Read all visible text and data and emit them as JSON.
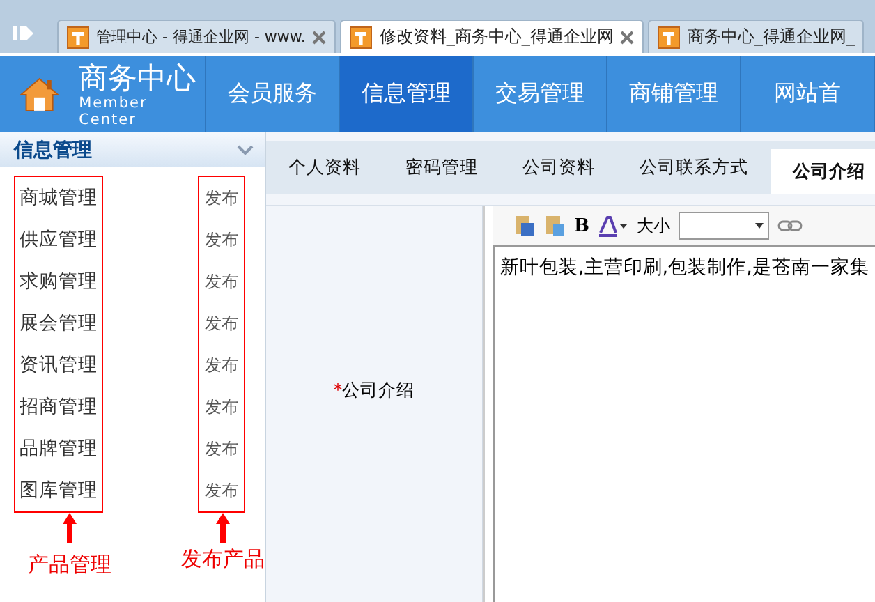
{
  "browser_tabs": [
    {
      "title": "管理中心 - 得通企业网 - www.",
      "selected": false,
      "closable": true
    },
    {
      "title": "修改资料_商务中心_得通企业网",
      "selected": true,
      "closable": true
    },
    {
      "title": "商务中心_得通企业网_",
      "selected": false,
      "closable": false
    }
  ],
  "header": {
    "title": "商务中心",
    "subtitle": "Member Center"
  },
  "nav": [
    {
      "label": "会员服务",
      "selected": false
    },
    {
      "label": "信息管理",
      "selected": true
    },
    {
      "label": "交易管理",
      "selected": false
    },
    {
      "label": "商铺管理",
      "selected": false
    },
    {
      "label": "网站首",
      "selected": false
    }
  ],
  "sidebar": {
    "title": "信息管理",
    "items": [
      {
        "label": "商城管理",
        "action": "发布"
      },
      {
        "label": "供应管理",
        "action": "发布"
      },
      {
        "label": "求购管理",
        "action": "发布"
      },
      {
        "label": "展会管理",
        "action": "发布"
      },
      {
        "label": "资讯管理",
        "action": "发布"
      },
      {
        "label": "招商管理",
        "action": "发布"
      },
      {
        "label": "品牌管理",
        "action": "发布"
      },
      {
        "label": "图库管理",
        "action": "发布"
      }
    ]
  },
  "annotations": [
    "产品管理",
    "发布产品"
  ],
  "content_tabs": [
    {
      "label": "个人资料",
      "selected": false
    },
    {
      "label": "密码管理",
      "selected": false
    },
    {
      "label": "公司资料",
      "selected": false
    },
    {
      "label": "公司联系方式",
      "selected": false
    },
    {
      "label": "公司介绍",
      "selected": true
    }
  ],
  "form": {
    "required_mark": "*",
    "label": "公司介绍",
    "toolbar": {
      "bold": "B",
      "size_label": "大小"
    },
    "value": "新叶包装,主营印刷,包装制作,是苍南一家集"
  }
}
